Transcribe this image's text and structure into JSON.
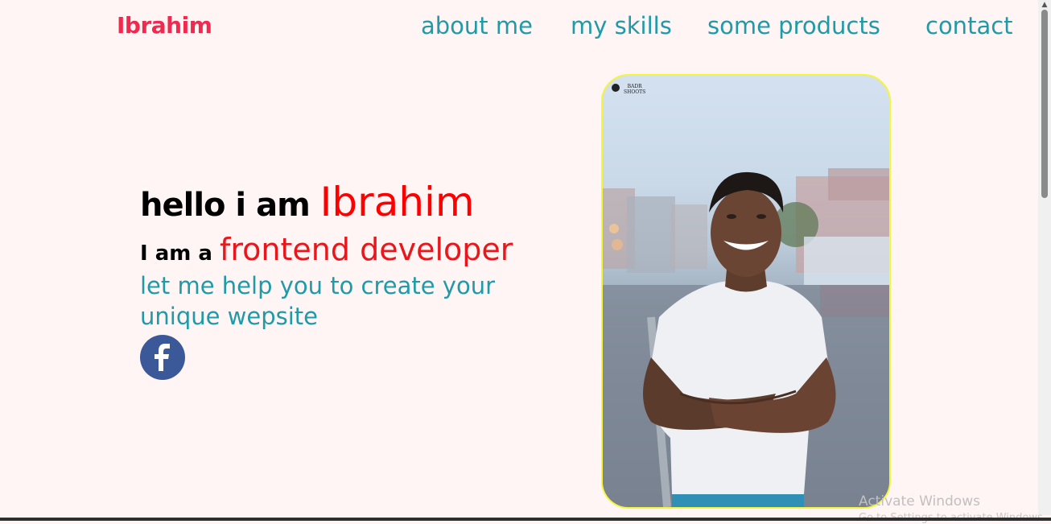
{
  "header": {
    "logo": "Ibrahim",
    "nav": [
      {
        "label": "about me"
      },
      {
        "label": "my skills"
      },
      {
        "label": "some products"
      },
      {
        "label": "contact"
      }
    ]
  },
  "hero": {
    "greeting_lead": "hello i am ",
    "greeting_name": "Ibrahim",
    "role_lead": "I am a ",
    "role_title": "frontend developer",
    "tagline": "let me help you to create your unique wepsite",
    "social": [
      {
        "icon": "facebook-icon"
      }
    ]
  },
  "photo": {
    "watermark_line1": "BADR",
    "watermark_line2": "SHOOTS"
  },
  "os_overlay": {
    "activate_title": "Activate Windows",
    "activate_sub": "Go to Settings to activate Windows."
  },
  "colors": {
    "logo": "#f0294e",
    "nav": "#1f9aa8",
    "accent_red": "#ff0000",
    "teal_text": "#1f9aa8",
    "facebook": "#3b5998",
    "photo_border": "#f5f53a",
    "background": "#fff5f4"
  }
}
